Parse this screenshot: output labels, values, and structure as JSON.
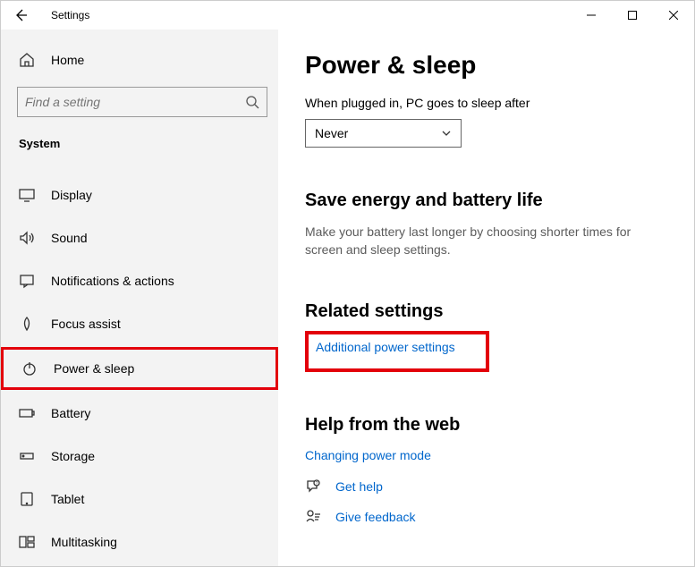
{
  "window": {
    "title": "Settings"
  },
  "sidebar": {
    "home": "Home",
    "search_placeholder": "Find a setting",
    "section": "System",
    "items": [
      {
        "label": "Display"
      },
      {
        "label": "Sound"
      },
      {
        "label": "Notifications & actions"
      },
      {
        "label": "Focus assist"
      },
      {
        "label": "Power & sleep"
      },
      {
        "label": "Battery"
      },
      {
        "label": "Storage"
      },
      {
        "label": "Tablet"
      },
      {
        "label": "Multitasking"
      }
    ]
  },
  "main": {
    "title": "Power & sleep",
    "sleep_label": "When plugged in, PC goes to sleep after",
    "sleep_value": "Never",
    "save_heading": "Save energy and battery life",
    "save_text": "Make your battery last longer by choosing shorter times for screen and sleep settings.",
    "related_heading": "Related settings",
    "related_link": "Additional power settings",
    "help_heading": "Help from the web",
    "help_link": "Changing power mode",
    "get_help": "Get help",
    "give_feedback": "Give feedback"
  }
}
